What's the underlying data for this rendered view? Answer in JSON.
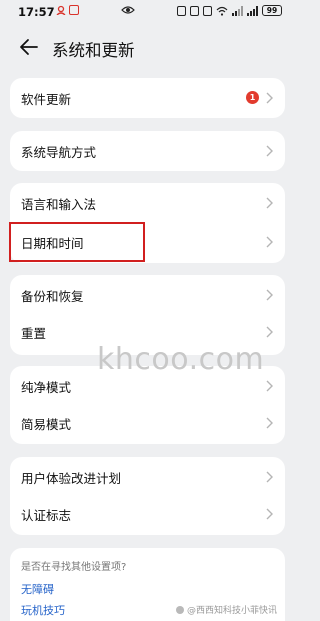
{
  "status_bar": {
    "time": "17:57",
    "battery": "99"
  },
  "header": {
    "title": "系统和更新"
  },
  "groups": [
    {
      "items": [
        {
          "label": "软件更新",
          "badge": "1"
        }
      ]
    },
    {
      "items": [
        {
          "label": "系统导航方式"
        }
      ]
    },
    {
      "items": [
        {
          "label": "语言和输入法"
        },
        {
          "label": "日期和时间"
        }
      ]
    },
    {
      "items": [
        {
          "label": "备份和恢复"
        },
        {
          "label": "重置"
        }
      ]
    },
    {
      "items": [
        {
          "label": "纯净模式"
        },
        {
          "label": "简易模式"
        }
      ]
    },
    {
      "items": [
        {
          "label": "用户体验改进计划"
        },
        {
          "label": "认证标志"
        }
      ]
    }
  ],
  "suggestions": {
    "question": "是否在寻找其他设置项?",
    "links": [
      "无障碍",
      "玩机技巧"
    ]
  },
  "watermark": "khcoo.com",
  "credit": "@西西知科技小菲快讯",
  "colors": {
    "background": "#eeeff1",
    "badge": "#e23b2e",
    "link": "#2563c9",
    "highlight": "#d11f1f"
  }
}
